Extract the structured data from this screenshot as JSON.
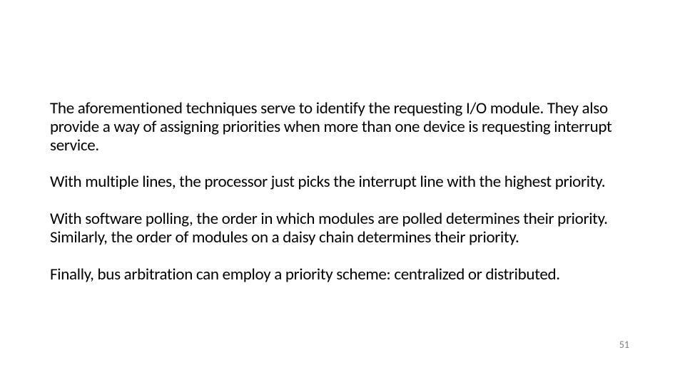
{
  "slide": {
    "paragraphs": [
      "The aforementioned techniques serve to identify the requesting I/O module. They also provide a way of assigning priorities when more than one device is requesting interrupt service.",
      "With multiple lines, the processor just picks the interrupt line with the highest priority.",
      "With software polling, the order in which modules are polled determines their priority. Similarly, the order of modules on a daisy chain determines their priority.",
      "Finally, bus arbitration can employ a priority scheme: centralized or distributed."
    ],
    "page_number": "51"
  }
}
